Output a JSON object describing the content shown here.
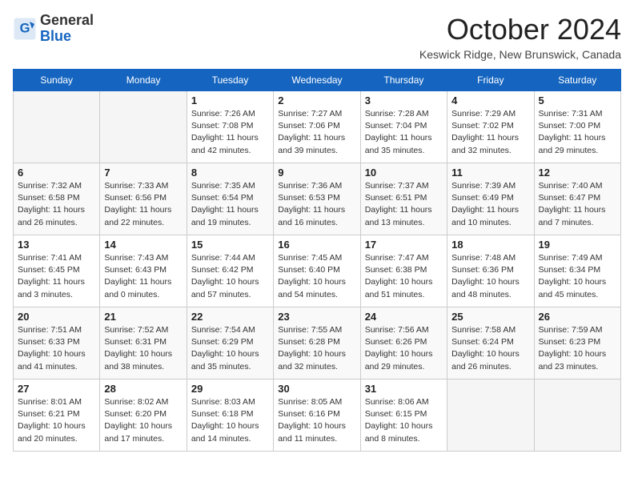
{
  "header": {
    "logo_general": "General",
    "logo_blue": "Blue",
    "month_title": "October 2024",
    "location": "Keswick Ridge, New Brunswick, Canada"
  },
  "days_of_week": [
    "Sunday",
    "Monday",
    "Tuesday",
    "Wednesday",
    "Thursday",
    "Friday",
    "Saturday"
  ],
  "weeks": [
    [
      {
        "day": "",
        "info": ""
      },
      {
        "day": "",
        "info": ""
      },
      {
        "day": "1",
        "info": "Sunrise: 7:26 AM\nSunset: 7:08 PM\nDaylight: 11 hours and 42 minutes."
      },
      {
        "day": "2",
        "info": "Sunrise: 7:27 AM\nSunset: 7:06 PM\nDaylight: 11 hours and 39 minutes."
      },
      {
        "day": "3",
        "info": "Sunrise: 7:28 AM\nSunset: 7:04 PM\nDaylight: 11 hours and 35 minutes."
      },
      {
        "day": "4",
        "info": "Sunrise: 7:29 AM\nSunset: 7:02 PM\nDaylight: 11 hours and 32 minutes."
      },
      {
        "day": "5",
        "info": "Sunrise: 7:31 AM\nSunset: 7:00 PM\nDaylight: 11 hours and 29 minutes."
      }
    ],
    [
      {
        "day": "6",
        "info": "Sunrise: 7:32 AM\nSunset: 6:58 PM\nDaylight: 11 hours and 26 minutes."
      },
      {
        "day": "7",
        "info": "Sunrise: 7:33 AM\nSunset: 6:56 PM\nDaylight: 11 hours and 22 minutes."
      },
      {
        "day": "8",
        "info": "Sunrise: 7:35 AM\nSunset: 6:54 PM\nDaylight: 11 hours and 19 minutes."
      },
      {
        "day": "9",
        "info": "Sunrise: 7:36 AM\nSunset: 6:53 PM\nDaylight: 11 hours and 16 minutes."
      },
      {
        "day": "10",
        "info": "Sunrise: 7:37 AM\nSunset: 6:51 PM\nDaylight: 11 hours and 13 minutes."
      },
      {
        "day": "11",
        "info": "Sunrise: 7:39 AM\nSunset: 6:49 PM\nDaylight: 11 hours and 10 minutes."
      },
      {
        "day": "12",
        "info": "Sunrise: 7:40 AM\nSunset: 6:47 PM\nDaylight: 11 hours and 7 minutes."
      }
    ],
    [
      {
        "day": "13",
        "info": "Sunrise: 7:41 AM\nSunset: 6:45 PM\nDaylight: 11 hours and 3 minutes."
      },
      {
        "day": "14",
        "info": "Sunrise: 7:43 AM\nSunset: 6:43 PM\nDaylight: 11 hours and 0 minutes."
      },
      {
        "day": "15",
        "info": "Sunrise: 7:44 AM\nSunset: 6:42 PM\nDaylight: 10 hours and 57 minutes."
      },
      {
        "day": "16",
        "info": "Sunrise: 7:45 AM\nSunset: 6:40 PM\nDaylight: 10 hours and 54 minutes."
      },
      {
        "day": "17",
        "info": "Sunrise: 7:47 AM\nSunset: 6:38 PM\nDaylight: 10 hours and 51 minutes."
      },
      {
        "day": "18",
        "info": "Sunrise: 7:48 AM\nSunset: 6:36 PM\nDaylight: 10 hours and 48 minutes."
      },
      {
        "day": "19",
        "info": "Sunrise: 7:49 AM\nSunset: 6:34 PM\nDaylight: 10 hours and 45 minutes."
      }
    ],
    [
      {
        "day": "20",
        "info": "Sunrise: 7:51 AM\nSunset: 6:33 PM\nDaylight: 10 hours and 41 minutes."
      },
      {
        "day": "21",
        "info": "Sunrise: 7:52 AM\nSunset: 6:31 PM\nDaylight: 10 hours and 38 minutes."
      },
      {
        "day": "22",
        "info": "Sunrise: 7:54 AM\nSunset: 6:29 PM\nDaylight: 10 hours and 35 minutes."
      },
      {
        "day": "23",
        "info": "Sunrise: 7:55 AM\nSunset: 6:28 PM\nDaylight: 10 hours and 32 minutes."
      },
      {
        "day": "24",
        "info": "Sunrise: 7:56 AM\nSunset: 6:26 PM\nDaylight: 10 hours and 29 minutes."
      },
      {
        "day": "25",
        "info": "Sunrise: 7:58 AM\nSunset: 6:24 PM\nDaylight: 10 hours and 26 minutes."
      },
      {
        "day": "26",
        "info": "Sunrise: 7:59 AM\nSunset: 6:23 PM\nDaylight: 10 hours and 23 minutes."
      }
    ],
    [
      {
        "day": "27",
        "info": "Sunrise: 8:01 AM\nSunset: 6:21 PM\nDaylight: 10 hours and 20 minutes."
      },
      {
        "day": "28",
        "info": "Sunrise: 8:02 AM\nSunset: 6:20 PM\nDaylight: 10 hours and 17 minutes."
      },
      {
        "day": "29",
        "info": "Sunrise: 8:03 AM\nSunset: 6:18 PM\nDaylight: 10 hours and 14 minutes."
      },
      {
        "day": "30",
        "info": "Sunrise: 8:05 AM\nSunset: 6:16 PM\nDaylight: 10 hours and 11 minutes."
      },
      {
        "day": "31",
        "info": "Sunrise: 8:06 AM\nSunset: 6:15 PM\nDaylight: 10 hours and 8 minutes."
      },
      {
        "day": "",
        "info": ""
      },
      {
        "day": "",
        "info": ""
      }
    ]
  ]
}
